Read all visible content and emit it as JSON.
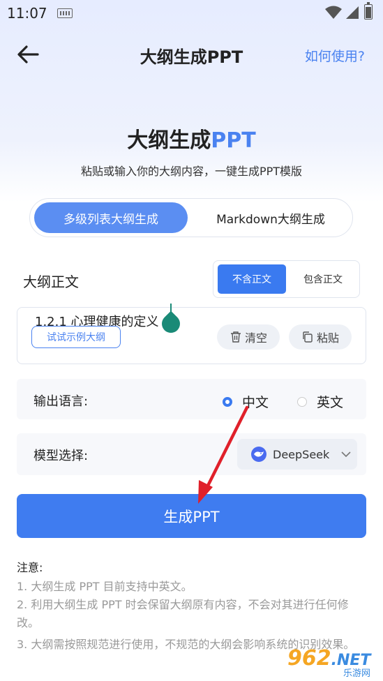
{
  "status": {
    "time": "11:07"
  },
  "nav": {
    "title": "大纲生成PPT",
    "help": "如何使用?"
  },
  "hero": {
    "title_main": "大纲生成",
    "title_accent": "PPT",
    "subtitle": "粘贴或输入你的大纲内容，一键生成PPT模版"
  },
  "mode_tabs": [
    {
      "label": "多级列表大纲生成",
      "active": true
    },
    {
      "label": "Markdown大纲生成",
      "active": false
    }
  ],
  "outline": {
    "label": "大纲正文",
    "toggle": [
      {
        "label": "不含正文",
        "active": true
      },
      {
        "label": "包含正文",
        "active": false
      }
    ],
    "input_value": "1.2.1 心理健康的定义",
    "example_button": "试试示例大纲",
    "clear_button": "清空",
    "paste_button": "粘贴"
  },
  "language": {
    "label": "输出语言:",
    "options": [
      {
        "label": "中文",
        "checked": true
      },
      {
        "label": "英文",
        "checked": false
      }
    ]
  },
  "model": {
    "label": "模型选择:",
    "selected": "DeepSeek",
    "icon": "deepseek-whale-icon"
  },
  "generate_button": "生成PPT",
  "notes": {
    "title": "注意:",
    "items": [
      "1. 大纲生成 PPT 目前支持中英文。",
      "2. 利用大纲生成 PPT 时会保留大纲原有内容，不会对其进行任何修改。",
      "3. 大纲需按照规范进行使用，不规范的大纲会影响系统的识别效果。"
    ]
  },
  "watermark": {
    "logo": "962",
    "logo_suffix": ".NET",
    "sub": "乐游网"
  },
  "colors": {
    "accent": "#3f7cf0",
    "annotation_arrow": "#e0202a"
  }
}
